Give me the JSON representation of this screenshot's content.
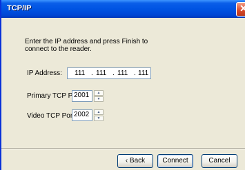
{
  "window": {
    "title": "TCP/IP"
  },
  "instruction": "Enter the IP address and press Finish to connect to the reader.",
  "ip_address": {
    "label": "IP Address:",
    "octets": [
      "111",
      "111",
      "111",
      "111"
    ]
  },
  "primary_port": {
    "label": "Primary TCP Port:",
    "value": "2001"
  },
  "video_port": {
    "label": "Video TCP Port:",
    "value": "2002"
  },
  "buttons": {
    "back": "‹ Back",
    "connect": "Connect",
    "cancel": "Cancel"
  },
  "icons": {
    "close": "close-icon",
    "spin_up": "spin-up-icon",
    "spin_down": "spin-down-icon"
  }
}
